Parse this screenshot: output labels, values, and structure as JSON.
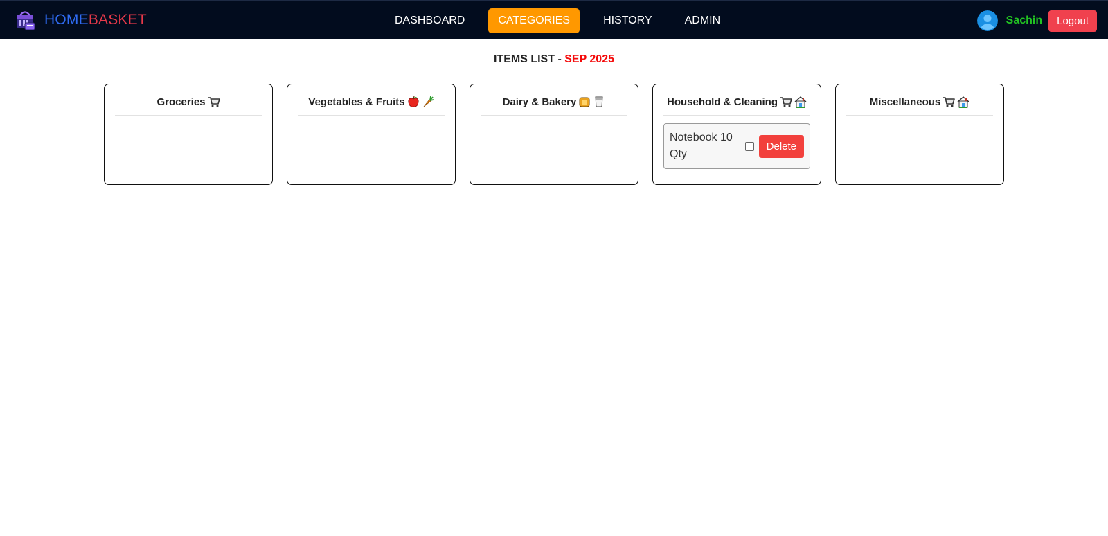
{
  "brand": {
    "part1": "HOME",
    "part2": "BASKET",
    "logo_icon": "basket-logo-icon"
  },
  "nav": {
    "links": [
      {
        "label": "DASHBOARD",
        "active": false
      },
      {
        "label": "CATEGORIES",
        "active": true
      },
      {
        "label": "HISTORY",
        "active": false
      },
      {
        "label": "ADMIN",
        "active": false
      }
    ]
  },
  "user": {
    "name": "Sachin",
    "logout_label": "Logout",
    "avatar_icon": "user-avatar-icon"
  },
  "heading": {
    "prefix": "ITEMS LIST - ",
    "month": "SEP 2025"
  },
  "categories": [
    {
      "title": "Groceries",
      "icons": [
        "cart-icon"
      ],
      "items": []
    },
    {
      "title": "Vegetables & Fruits",
      "icons": [
        "apple-icon",
        "carrot-icon"
      ],
      "items": []
    },
    {
      "title": "Dairy & Bakery",
      "icons": [
        "bread-icon",
        "milk-glass-icon"
      ],
      "items": []
    },
    {
      "title": "Household & Cleaning",
      "icons": [
        "cart-icon",
        "house-icon"
      ],
      "items": [
        {
          "name": "Notebook",
          "qty_text": "10 Qty",
          "checked": false,
          "delete_label": "Delete"
        }
      ]
    },
    {
      "title": "Miscellaneous",
      "icons": [
        "cart-icon",
        "house-icon"
      ],
      "items": []
    }
  ],
  "colors": {
    "navbar_bg": "#020c1e",
    "active_tab": "#ff9800",
    "brand_home": "#2f6bf2",
    "brand_basket": "#e8394a",
    "username": "#22c322",
    "logout": "#f0414e",
    "month": "#f40b0b",
    "delete": "#f2403c"
  }
}
